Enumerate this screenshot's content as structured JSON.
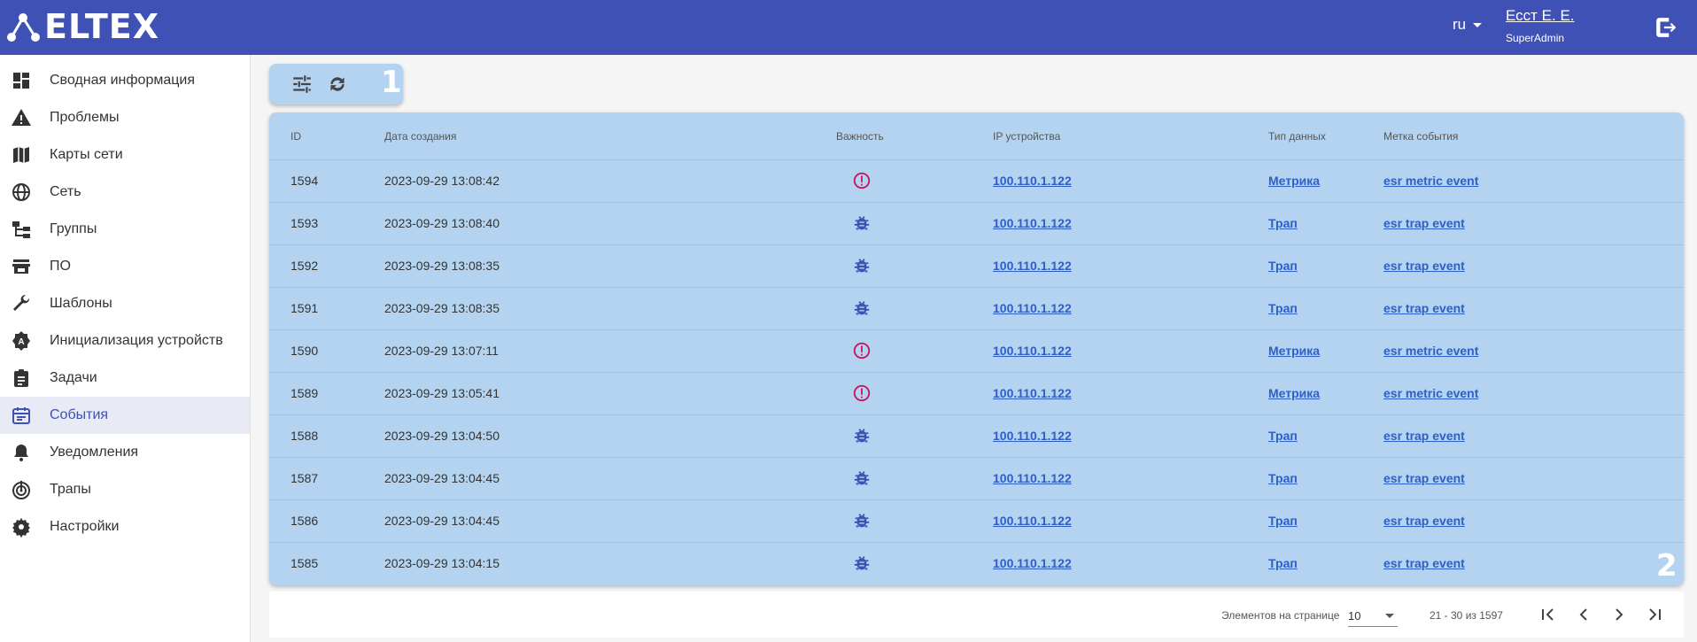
{
  "header": {
    "logo_text": "ELTEX",
    "lang": "ru",
    "user_name": "Есст Е. Е.",
    "user_role": "SuperAdmin"
  },
  "sidebar": {
    "items": [
      {
        "label": "Сводная информация",
        "icon": "dashboard-icon"
      },
      {
        "label": "Проблемы",
        "icon": "warning-icon"
      },
      {
        "label": "Карты сети",
        "icon": "map-icon"
      },
      {
        "label": "Сеть",
        "icon": "globe-icon"
      },
      {
        "label": "Группы",
        "icon": "groups-tree-icon"
      },
      {
        "label": "ПО",
        "icon": "store-icon"
      },
      {
        "label": "Шаблоны",
        "icon": "wrench-icon"
      },
      {
        "label": "Инициализация устройств",
        "icon": "init-gear-icon"
      },
      {
        "label": "Задачи",
        "icon": "clipboard-icon"
      },
      {
        "label": "События",
        "icon": "calendar-icon",
        "active": true
      },
      {
        "label": "Уведомления",
        "icon": "bell-icon"
      },
      {
        "label": "Трапы",
        "icon": "trap-icon"
      },
      {
        "label": "Настройки",
        "icon": "gear-icon"
      }
    ]
  },
  "callouts": {
    "one": "1",
    "two": "2"
  },
  "table": {
    "headers": {
      "id": "ID",
      "date": "Дата создания",
      "severity": "Важность",
      "ip": "IP устройства",
      "type": "Тип данных",
      "label": "Метка события"
    },
    "rows": [
      {
        "id": "1594",
        "date": "2023-09-29 13:08:42",
        "severity": "metric",
        "ip": "100.110.1.122",
        "type": "Метрика",
        "label": "esr metric event"
      },
      {
        "id": "1593",
        "date": "2023-09-29 13:08:40",
        "severity": "trap",
        "ip": "100.110.1.122",
        "type": "Трап",
        "label": "esr trap event"
      },
      {
        "id": "1592",
        "date": "2023-09-29 13:08:35",
        "severity": "trap",
        "ip": "100.110.1.122",
        "type": "Трап",
        "label": "esr trap event"
      },
      {
        "id": "1591",
        "date": "2023-09-29 13:08:35",
        "severity": "trap",
        "ip": "100.110.1.122",
        "type": "Трап",
        "label": "esr trap event"
      },
      {
        "id": "1590",
        "date": "2023-09-29 13:07:11",
        "severity": "metric",
        "ip": "100.110.1.122",
        "type": "Метрика",
        "label": "esr metric event"
      },
      {
        "id": "1589",
        "date": "2023-09-29 13:05:41",
        "severity": "metric",
        "ip": "100.110.1.122",
        "type": "Метрика",
        "label": "esr metric event"
      },
      {
        "id": "1588",
        "date": "2023-09-29 13:04:50",
        "severity": "trap",
        "ip": "100.110.1.122",
        "type": "Трап",
        "label": "esr trap event"
      },
      {
        "id": "1587",
        "date": "2023-09-29 13:04:45",
        "severity": "trap",
        "ip": "100.110.1.122",
        "type": "Трап",
        "label": "esr trap event"
      },
      {
        "id": "1586",
        "date": "2023-09-29 13:04:45",
        "severity": "trap",
        "ip": "100.110.1.122",
        "type": "Трап",
        "label": "esr trap event"
      },
      {
        "id": "1585",
        "date": "2023-09-29 13:04:15",
        "severity": "trap",
        "ip": "100.110.1.122",
        "type": "Трап",
        "label": "esr trap event"
      }
    ]
  },
  "pager": {
    "per_page_label": "Элементов на странице",
    "per_page_value": "10",
    "range": "21 - 30 из 1597"
  },
  "colors": {
    "header": "#3f51b5",
    "table_bg": "#b3d3f0",
    "link": "#2f5fc4",
    "metric_icon": "#c2185b",
    "trap_icon": "#3f51b5"
  }
}
